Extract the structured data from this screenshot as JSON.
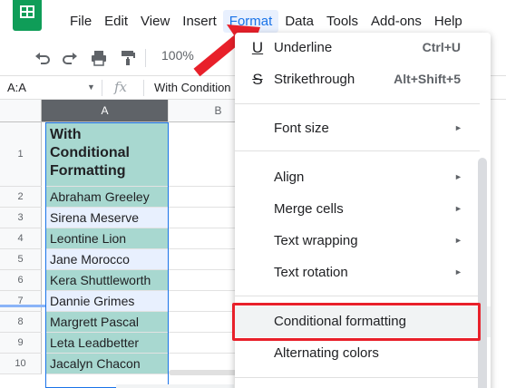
{
  "menubar": {
    "items": [
      "File",
      "Edit",
      "View",
      "Insert",
      "Format",
      "Data",
      "Tools",
      "Add-ons",
      "Help"
    ],
    "active": "Format"
  },
  "toolbar": {
    "undo_icon": "undo-icon",
    "redo_icon": "redo-icon",
    "print_icon": "print-icon",
    "paint_format_icon": "paint-format-icon",
    "zoom": "100%"
  },
  "formula_bar": {
    "name_box": "A:A",
    "fx": "fx",
    "content": "With Condition"
  },
  "grid": {
    "columns": [
      "A",
      "B"
    ],
    "header_cell": "With Conditional Formatting",
    "rows": [
      {
        "num": "1"
      },
      {
        "num": "2",
        "value": "Abraham Greeley",
        "style": "teal"
      },
      {
        "num": "3",
        "value": "Sirena Meserve",
        "style": "light"
      },
      {
        "num": "4",
        "value": "Leontine Lion",
        "style": "teal"
      },
      {
        "num": "5",
        "value": "Jane Morocco",
        "style": "light"
      },
      {
        "num": "6",
        "value": "Kera Shuttleworth",
        "style": "teal"
      },
      {
        "num": "7",
        "value": "Dannie Grimes",
        "style": "light"
      },
      {
        "num": "8",
        "value": "Margrett Pascal",
        "style": "teal"
      },
      {
        "num": "9",
        "value": "Leta Leadbetter",
        "style": "teal"
      },
      {
        "num": "10",
        "value": "Jacalyn Chacon",
        "style": "teal"
      }
    ],
    "colors": {
      "teal": "#a8d8d0",
      "light": "#e8f0fe",
      "selection": "#1a73e8"
    }
  },
  "format_menu": {
    "underline": {
      "label": "Underline",
      "shortcut": "Ctrl+U",
      "icon": "underline-icon"
    },
    "strikethrough": {
      "label": "Strikethrough",
      "shortcut": "Alt+Shift+5",
      "icon": "strikethrough-icon"
    },
    "font_size": {
      "label": "Font size"
    },
    "align": {
      "label": "Align"
    },
    "merge_cells": {
      "label": "Merge cells"
    },
    "text_wrapping": {
      "label": "Text wrapping"
    },
    "text_rotation": {
      "label": "Text rotation"
    },
    "conditional_formatting": {
      "label": "Conditional formatting"
    },
    "alternating_colors": {
      "label": "Alternating colors"
    }
  },
  "annotation": {
    "color": "#e8202a"
  }
}
